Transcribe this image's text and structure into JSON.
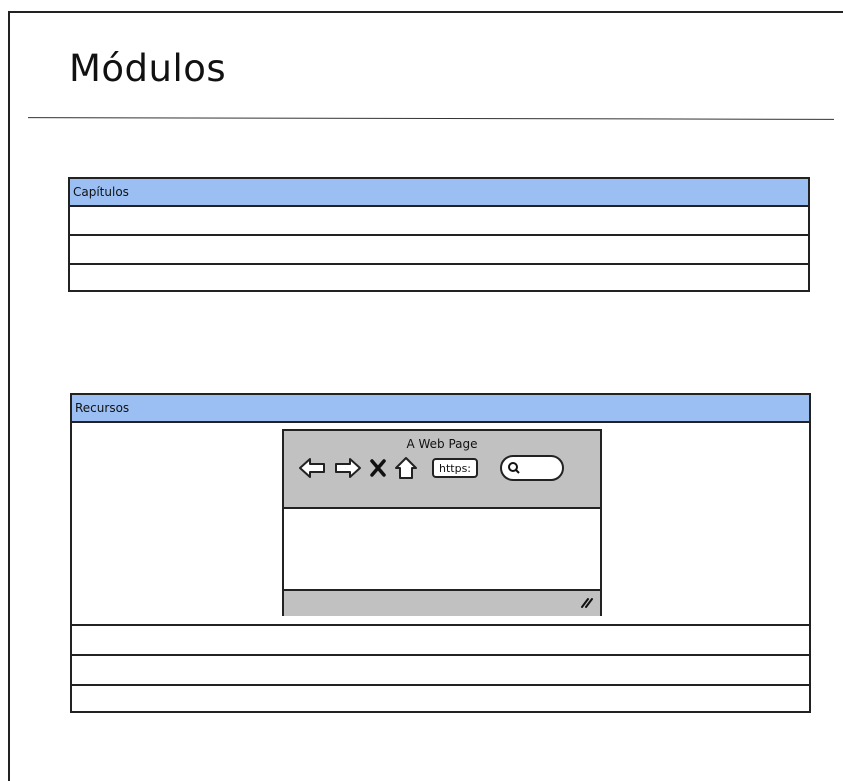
{
  "page": {
    "title": "Módulos"
  },
  "capitulos": {
    "header": "Capítulos",
    "rows": [
      "",
      "",
      ""
    ]
  },
  "recursos": {
    "header": "Recursos",
    "browser": {
      "title": "A Web Page",
      "url": "https:",
      "icons": [
        "back-arrow-icon",
        "forward-arrow-icon",
        "stop-icon",
        "home-icon",
        "search-icon",
        "resize-grip-icon"
      ]
    },
    "rows": [
      "",
      "",
      ""
    ]
  },
  "colors": {
    "header_fill": "#9cbff3",
    "browser_chrome": "#c1c1c1",
    "stroke": "#222222"
  }
}
